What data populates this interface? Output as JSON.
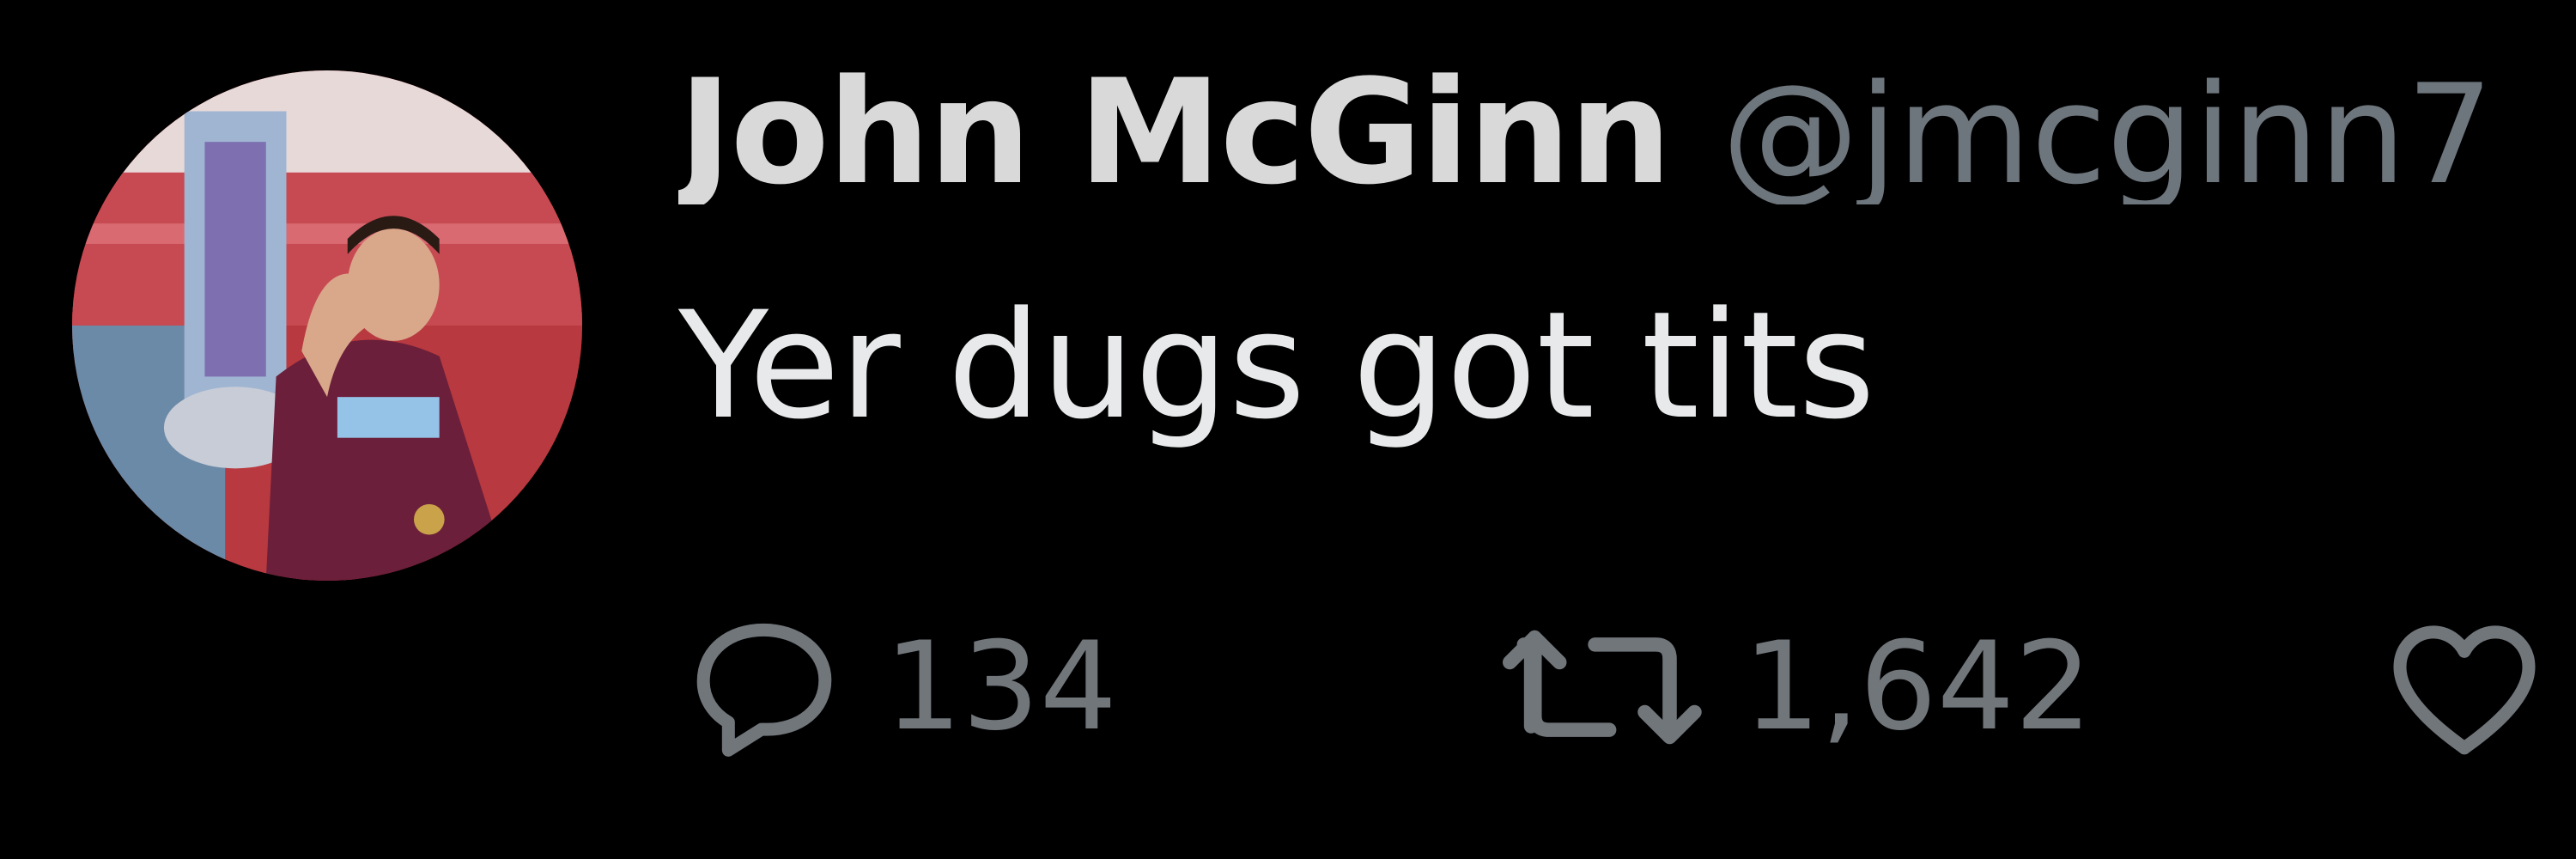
{
  "tweet": {
    "author": {
      "display_name": "John McGinn",
      "handle": "@jmcginn7"
    },
    "text": "Yer dugs got tits",
    "stats": {
      "replies": "134",
      "retweets": "1,642"
    },
    "icons": {
      "reply": "reply-bubble-icon",
      "retweet": "retweet-icon",
      "like": "heart-icon"
    },
    "colors": {
      "background": "#000000",
      "name": "#d9d9d9",
      "secondary": "#71767b",
      "text": "#e7e9ea"
    }
  }
}
